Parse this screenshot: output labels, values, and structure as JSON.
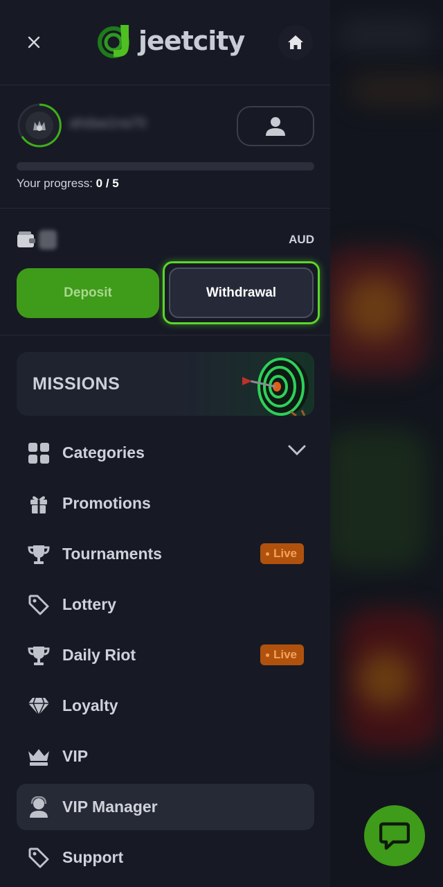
{
  "header": {
    "logo_text": "jeetcity",
    "close_icon": "close-icon",
    "home_icon": "home-icon"
  },
  "user": {
    "username": "ahdaa1na70",
    "progress_label": "Your progress:",
    "progress_value": "0 / 5",
    "progress_fraction": 0
  },
  "wallet": {
    "currency": "AUD",
    "deposit_label": "Deposit",
    "withdrawal_label": "Withdrawal"
  },
  "missions": {
    "label": "MISSIONS"
  },
  "menu": [
    {
      "label": "Categories",
      "icon": "grid-icon",
      "expandable": true
    },
    {
      "label": "Promotions",
      "icon": "gift-icon"
    },
    {
      "label": "Tournaments",
      "icon": "trophy-icon",
      "badge": "Live"
    },
    {
      "label": "Lottery",
      "icon": "tag-icon"
    },
    {
      "label": "Daily Riot",
      "icon": "trophy-icon",
      "badge": "Live"
    },
    {
      "label": "Loyalty",
      "icon": "diamond-icon"
    },
    {
      "label": "VIP",
      "icon": "crown-icon"
    },
    {
      "label": "VIP Manager",
      "icon": "manager-icon",
      "active": true
    },
    {
      "label": "Support",
      "icon": "tag-icon"
    }
  ],
  "colors": {
    "brand_green": "#3f9b1a",
    "highlight_green": "#5bd62a",
    "live_badge": "#b0520d",
    "drawer_bg": "#171a24"
  }
}
